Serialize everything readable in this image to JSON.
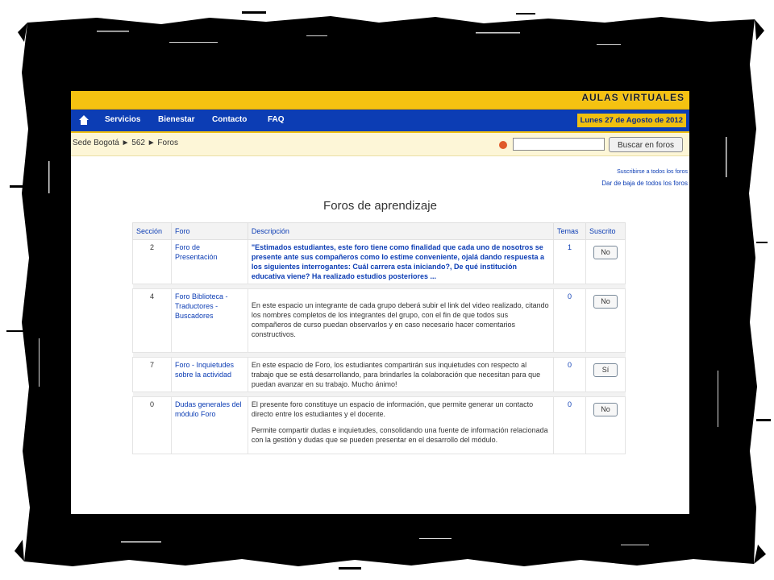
{
  "header": {
    "logo_text": "AULAS VIRTUALES"
  },
  "nav": {
    "items": [
      "Servicios",
      "Bienestar",
      "Contacto",
      "FAQ"
    ],
    "date": "Lunes 27 de Agosto de 2012"
  },
  "breadcrumb": "Sede Bogotá ► 562 ► Foros",
  "search": {
    "placeholder": "",
    "button_label": "Buscar en foros"
  },
  "links": {
    "subscribe_all": "Suscribirse a todos los foros",
    "unsubscribe_all": "Dar de baja de todos los foros"
  },
  "page_title": "Foros de aprendizaje",
  "table": {
    "headers": [
      "Sección",
      "Foro",
      "Descripción",
      "Temas",
      "Suscrito"
    ],
    "rows": [
      {
        "section": "2",
        "forum": "Foro de Presentación",
        "description": "\"Estimados estudiantes, este foro tiene como finalidad que cada uno de nosotros se presente ante sus compañeros como lo estime conveniente, ojalá dando respuesta a los siguientes interrogantes: Cuál carrera esta iniciando?, De qué institución educativa viene? Ha realizado estudios posteriores ...",
        "topics": "1",
        "subscribed": "No"
      },
      {
        "section": "4",
        "forum": "Foro Biblioteca - Traductores -Buscadores",
        "description": "En este espacio un integrante de cada grupo deberá subir el link del video realizado, citando los nombres completos de los integrantes del grupo, con el fin de que todos sus compañeros de curso puedan observarlos y en caso necesario hacer comentarios constructivos.",
        "topics": "0",
        "subscribed": "No"
      },
      {
        "section": "7",
        "forum": "Foro - Inquietudes sobre la actividad",
        "description": "En este espacio de Foro, los estudiantes compartirán sus inquietudes con respecto al trabajo que se está desarrollando, para brindarles la colaboración que necesitan para que puedan avanzar en su trabajo. Mucho ánimo!",
        "topics": "0",
        "subscribed": "Sí"
      },
      {
        "section": "0",
        "forum": "Dudas generales del módulo Foro",
        "description": "El presente foro constituye un espacio de información, que permite generar un contacto directo entre los estudiantes y el docente.",
        "description_2": "Permite compartir dudas e inquietudes, consolidando una fuente de información relacionada con la gestión y dudas que se pueden presentar en el desarrollo del módulo.",
        "topics": "0",
        "subscribed": "No"
      }
    ]
  },
  "colors": {
    "accent_yellow": "#f5c211",
    "nav_blue": "#0c3db4",
    "frame": "#000000"
  }
}
